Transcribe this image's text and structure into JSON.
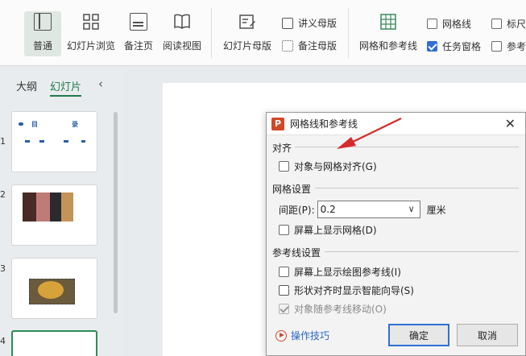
{
  "ribbon": {
    "view_buttons": [
      {
        "label": "普通",
        "icon": "normal-view-icon"
      },
      {
        "label": "幻灯片浏览",
        "icon": "slide-sorter-icon"
      },
      {
        "label": "备注页",
        "icon": "notes-page-icon"
      },
      {
        "label": "阅读视图",
        "icon": "reading-view-icon"
      }
    ],
    "master_button": {
      "label": "幻灯片母版",
      "icon": "slide-master-icon"
    },
    "handout_master": {
      "label": "讲义母版",
      "icon": "handout-master-icon"
    },
    "notes_master": {
      "label": "备注母版",
      "icon": "notes-master-icon"
    },
    "grid_guides": {
      "label": "网格和参考线",
      "icon": "grid-guides-icon"
    },
    "checks": [
      {
        "label": "网格线",
        "checked": false
      },
      {
        "label": "任务窗格",
        "checked": true
      },
      {
        "label": "标尺",
        "checked": false
      },
      {
        "label": "参考",
        "checked": false
      }
    ]
  },
  "panel": {
    "tabs": [
      "大纲",
      "幻灯片"
    ],
    "active_tab": "幻灯片",
    "collapse_icon": "chevron-left-icon",
    "slide_numbers": [
      "1",
      "2",
      "3",
      "4"
    ],
    "slide1_text": {
      "title_left": "目",
      "title_right": "录"
    }
  },
  "dialog": {
    "title": "网格线和参考线",
    "logo_letter": "P",
    "close_icon": "close-icon",
    "align_section": "对齐",
    "snap_to_grid": {
      "label": "对象与网格对齐(G)",
      "checked": false
    },
    "grid_section": "网格设置",
    "spacing_label": "间距(P):",
    "spacing_value": "0.2",
    "spacing_unit": "厘米",
    "show_grid": {
      "label": "屏幕上显示网格(D)",
      "checked": false
    },
    "guides_section": "参考线设置",
    "show_drawing_guides": {
      "label": "屏幕上显示绘图参考线(I)",
      "checked": false
    },
    "smart_guides": {
      "label": "形状对齐时显示智能向导(S)",
      "checked": true
    },
    "move_with_guides": {
      "label": "对象随参考线移动(O)",
      "checked": true,
      "disabled": true
    },
    "tips_label": "操作技巧",
    "ok_label": "确定",
    "cancel_label": "取消"
  },
  "colors": {
    "accent_green": "#1f7a4c",
    "checkbox_blue": "#2f6fd6",
    "arrow_red": "#d62b2b",
    "logo_red": "#d24726"
  }
}
